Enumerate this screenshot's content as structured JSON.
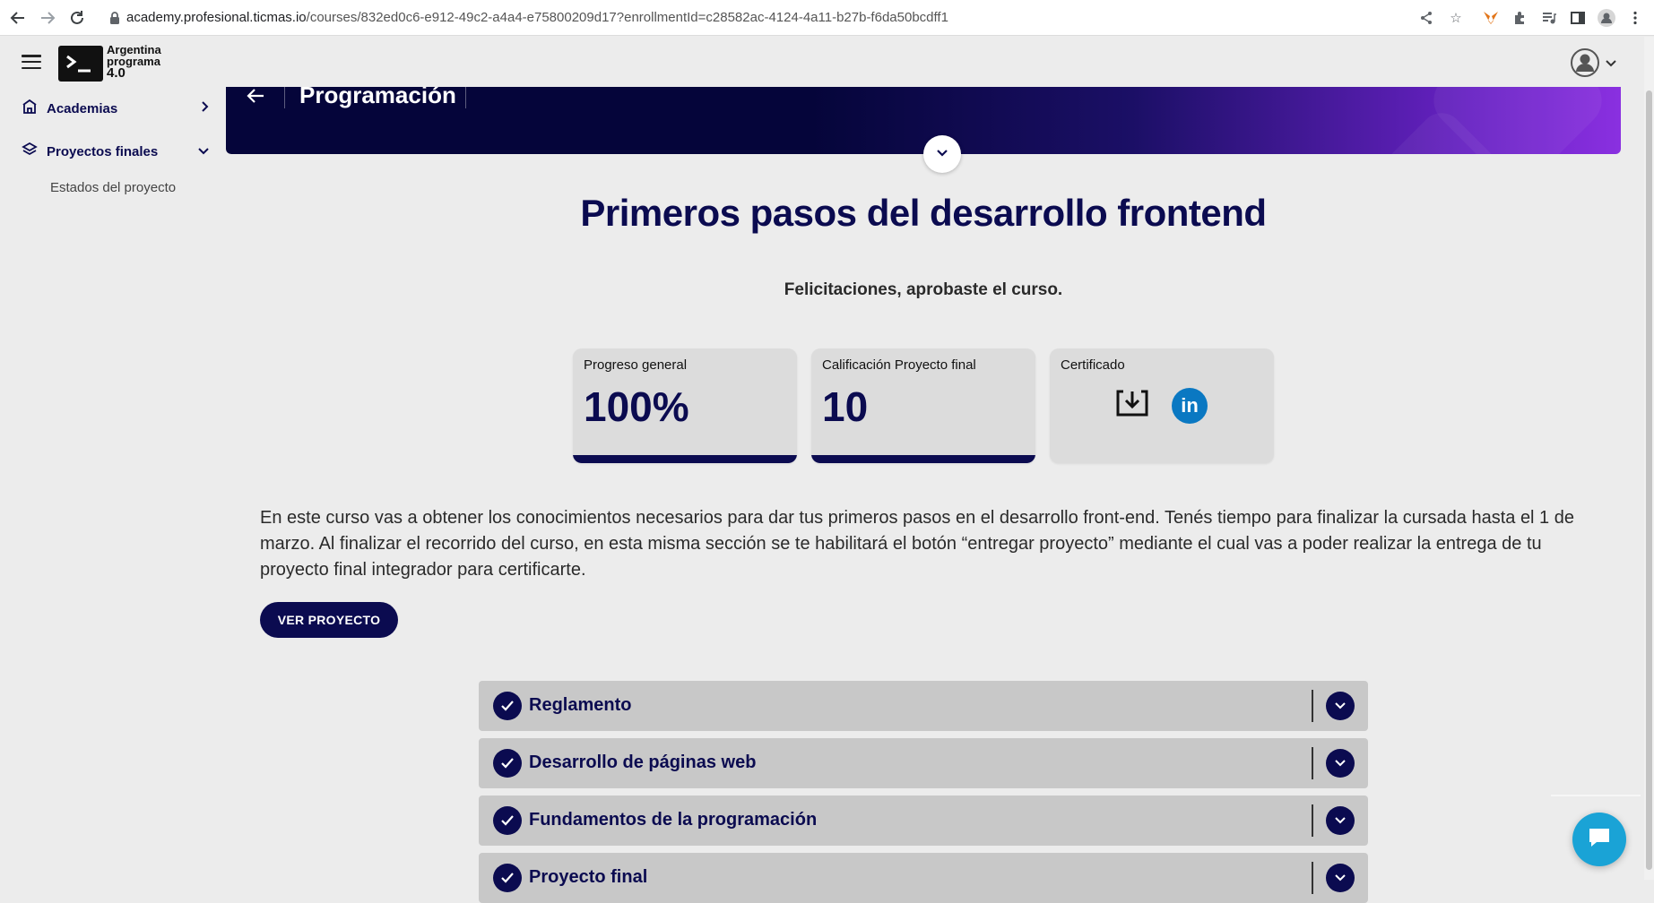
{
  "browser": {
    "url_host": "academy.profesional.ticmas.io",
    "url_path": "/courses/832ed0c6-e912-49c2-a4a4-e75800209d17?enrollmentId=c28582ac-4124-4a11-b27b-f6da50bcdff1"
  },
  "header": {
    "logo_line1": "Argentina",
    "logo_line2": "programa",
    "logo_line3": "4.0"
  },
  "sidebar": {
    "items": [
      {
        "label": "Academias",
        "icon": "academy-icon"
      },
      {
        "label": "Proyectos finales",
        "icon": "layers-icon"
      }
    ],
    "subitem": "Estados del proyecto"
  },
  "banner": {
    "title": "Programación"
  },
  "course": {
    "title": "Primeros pasos del desarrollo frontend",
    "congrats": "Felicitaciones, aprobaste el curso."
  },
  "cards": {
    "progress_label": "Progreso general",
    "progress_value": "100%",
    "progress_fraction": 1.0,
    "grade_label": "Calificación Proyecto final",
    "grade_value": "10",
    "grade_fraction": 1.0,
    "certificate_label": "Certificado",
    "linkedin_text": "in"
  },
  "description": "En este curso vas a obtener los conocimientos necesarios para dar tus primeros pasos en el desarrollo front-end. Tenés tiempo para finalizar la cursada hasta el 1 de marzo. Al finalizar el recorrido del curso, en esta misma sección se te habilitará el botón “entregar proyecto” mediante el cual vas a poder realizar la entrega de tu proyecto final integrador para certificarte.",
  "ver_proyecto_label": "VER PROYECTO",
  "modules": [
    {
      "name": "Reglamento"
    },
    {
      "name": "Desarrollo de páginas web"
    },
    {
      "name": "Fundamentos de la programación"
    },
    {
      "name": "Proyecto final"
    }
  ],
  "colors": {
    "brand_navy": "#0b0b50",
    "banner_purple": "#8a30e0",
    "linkedin_blue": "#0a78c2",
    "chat_blue": "#1aa3d6"
  }
}
